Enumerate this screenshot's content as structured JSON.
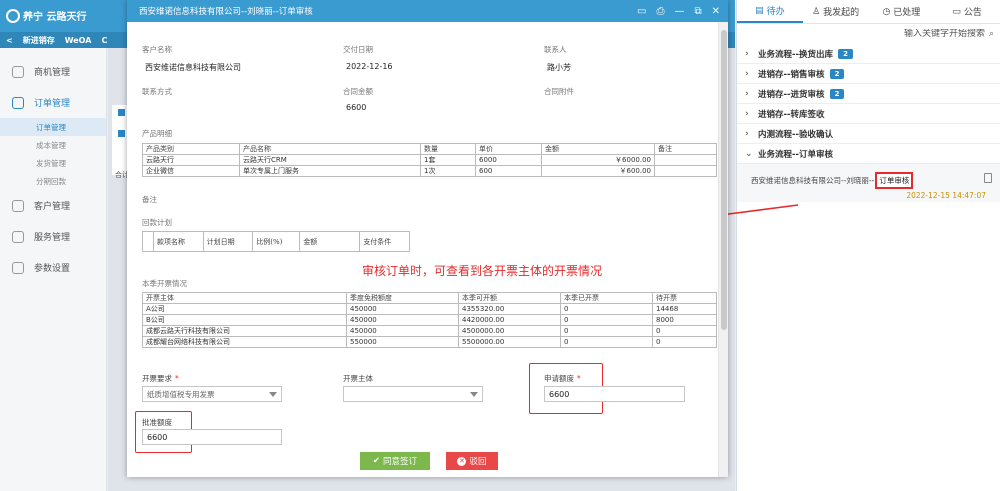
{
  "app": {
    "logo_text": "养宁 云路天行",
    "nav": [
      "新进销存",
      "WeOA",
      "C"
    ],
    "sidebar": [
      {
        "label": "商机管理",
        "icon": "target-icon"
      },
      {
        "label": "订单管理",
        "icon": "order-icon"
      },
      {
        "label": "客户管理",
        "icon": "customer-icon"
      },
      {
        "label": "服务管理",
        "icon": "heart-icon"
      },
      {
        "label": "参数设置",
        "icon": "settings-icon"
      }
    ],
    "sidebar_sub": [
      "订单管理",
      "成本管理",
      "发货管理",
      "分期回款"
    ],
    "bg_text": "合计"
  },
  "right_panel": {
    "tabs": [
      {
        "label": "待办",
        "icon": "inbox-icon"
      },
      {
        "label": "我发起的",
        "icon": "user-icon"
      },
      {
        "label": "已处理",
        "icon": "clock-icon"
      },
      {
        "label": "公告",
        "icon": "comment-icon"
      }
    ],
    "search_placeholder": "输入关键字开始搜索",
    "groups": [
      {
        "label": "业务流程--换货出库",
        "badge": "2"
      },
      {
        "label": "进销存--销售审核",
        "badge": "2"
      },
      {
        "label": "进销存--进货审核",
        "badge": "2"
      },
      {
        "label": "进销存--转库签收",
        "badge": ""
      },
      {
        "label": "内测流程--验收确认",
        "badge": ""
      },
      {
        "label": "业务流程--订单审核",
        "badge": ""
      }
    ],
    "item": {
      "title": "西安维诺信息科技有限公司--刘晓丽--",
      "tag": "订单审核",
      "time": "2022-12-15 14:47:07"
    }
  },
  "modal": {
    "title": "西安维诺信息科技有限公司--刘晓丽--订单审核",
    "fields": {
      "customer_label": "客户名称",
      "customer_value": "西安维诺信息科技有限公司",
      "delivery_label": "交付日期",
      "delivery_value": "2022-12-16",
      "contact_label": "联系人",
      "contact_value": "路小芳",
      "contact_method_label": "联系方式",
      "amount_label": "合同金额",
      "amount_value": "6600",
      "attachment_label": "合同附件"
    },
    "products": {
      "section_label": "产品明细",
      "headers": [
        "产品类别",
        "产品名称",
        "数量",
        "单价",
        "金额",
        "备注"
      ],
      "rows": [
        [
          "云路天行",
          "云路天行CRM",
          "1套",
          "6000",
          "￥6000.00",
          ""
        ],
        [
          "企业微信",
          "单次专属上门服务",
          "1次",
          "600",
          "￥600.00",
          ""
        ]
      ]
    },
    "remark_label": "备注",
    "payment": {
      "section_label": "回款计划",
      "headers": [
        "",
        "款项名称",
        "计划日期",
        "比例(%)",
        "金额",
        "支付条件"
      ]
    },
    "annotation": "审核订单时，可查看到各开票主体的开票情况",
    "invoice": {
      "section_label": "本季开票情况",
      "headers": [
        "开票主体",
        "季度免税额度",
        "本季可开额",
        "本季已开票",
        "待开票"
      ],
      "rows": [
        [
          "A公司",
          "450000",
          "4355320.00",
          "0",
          "14468"
        ],
        [
          "B公司",
          "450000",
          "4420000.00",
          "0",
          "8000"
        ],
        [
          "成都云路天行科技有限公司",
          "450000",
          "4500000.00",
          "0",
          "0"
        ],
        [
          "成都耀台网络科技有限公司",
          "550000",
          "5500000.00",
          "0",
          "0"
        ]
      ]
    },
    "form": {
      "invoice_req_label": "开票要求",
      "invoice_req_value": "纸质增值税专用发票",
      "invoice_subject_label": "开票主体",
      "invoice_subject_value": "",
      "apply_amount_label": "申请额度",
      "apply_amount_value": "6600",
      "approve_amount_label": "批准额度",
      "approve_amount_value": "6600",
      "required_mark": "*"
    },
    "buttons": {
      "approve": "同意签订",
      "reject": "驳回"
    }
  },
  "colors": {
    "primary": "#3a9bd0",
    "accent_red": "#e52b2b",
    "approve_green": "#7cb84c",
    "reject_red": "#e84848",
    "time_gold": "#c89200"
  }
}
